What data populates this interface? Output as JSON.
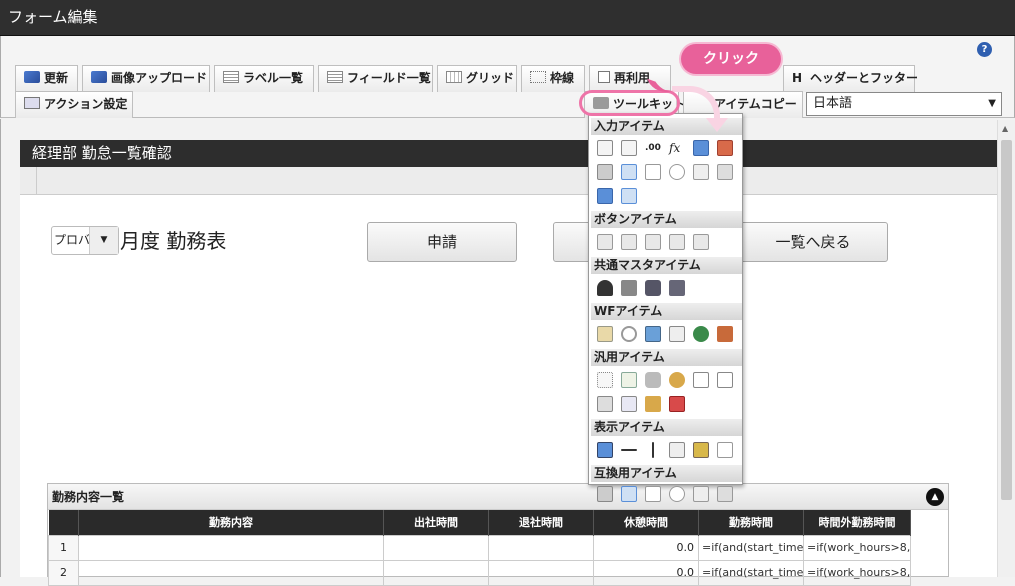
{
  "window_title": "フォーム編集",
  "help_icon": "?",
  "toolbar": {
    "items": [
      {
        "label": "更新",
        "icon": "refresh-icon"
      },
      {
        "label": "画像アップロード",
        "icon": "image-upload-icon"
      },
      {
        "label": "ラベル一覧",
        "icon": "label-list-icon"
      },
      {
        "label": "フィールド一覧",
        "icon": "field-list-icon"
      },
      {
        "label": "グリッド",
        "icon": "grid-icon"
      },
      {
        "label": "枠線",
        "icon": "border-icon"
      },
      {
        "label": "再利用",
        "icon": "reuse-icon"
      },
      {
        "label": "ヘッダーとフッター",
        "icon": "header-footer-icon"
      },
      {
        "label": "アクション設定",
        "icon": "action-icon"
      },
      {
        "label": "ツールキット",
        "icon": "toolkit-icon"
      },
      {
        "label": "アイテムコピー",
        "icon": "item-copy-icon"
      }
    ],
    "header_footer_prefix": "H",
    "language": "日本語"
  },
  "callout": "クリック",
  "form": {
    "header": "経理部 勤怠一覧確認",
    "select_value": "プロバ",
    "month_title": "月度 勤務表",
    "buttons": [
      "申請",
      "一覧へ戻る"
    ]
  },
  "toolkit": {
    "sections": [
      {
        "title": "入力アイテム"
      },
      {
        "title": "ボタンアイテム"
      },
      {
        "title": "共通マスタアイテム"
      },
      {
        "title": "WFアイテム"
      },
      {
        "title": "汎用アイテム"
      },
      {
        "title": "表示アイテム"
      },
      {
        "title": "互換用アイテム"
      }
    ],
    "numeric_icon_text": ".00",
    "formula_icon_text": "fx"
  },
  "table": {
    "title": "勤務内容一覧",
    "columns": [
      "",
      "勤務内容",
      "出社時間",
      "退社時間",
      "休憩時間",
      "勤務時間",
      "時間外勤務時間"
    ],
    "rows": [
      [
        "1",
        "",
        "",
        "",
        "0.0",
        "=if(and(start_time>",
        "=if(work_hours>8,"
      ],
      [
        "2",
        "",
        "",
        "",
        "0.0",
        "=if(and(start_time>",
        "=if(work_hours>8,"
      ]
    ]
  },
  "colors": {
    "accent": "#e8619a",
    "header": "#2d2d2d"
  }
}
